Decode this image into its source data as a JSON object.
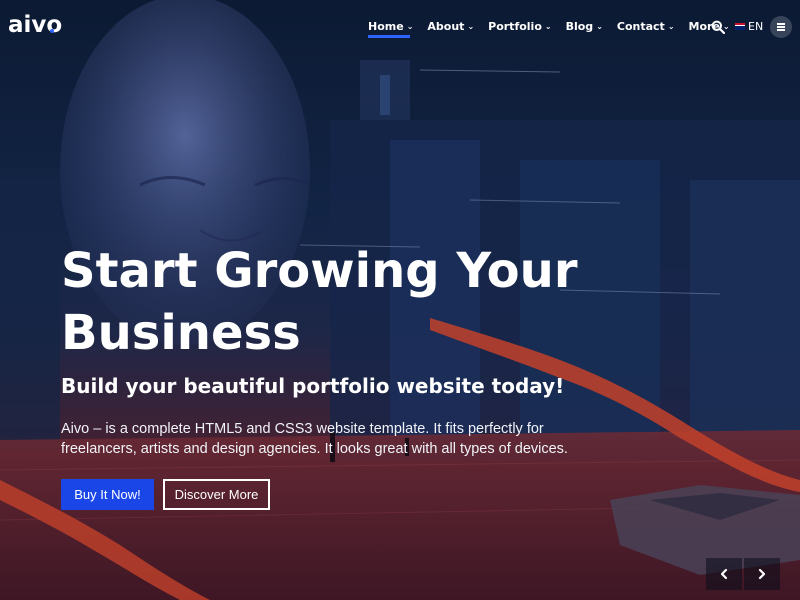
{
  "brand": {
    "logo": "aivo"
  },
  "nav": {
    "items": [
      {
        "label": "Home",
        "active": true
      },
      {
        "label": "About",
        "active": false
      },
      {
        "label": "Portfolio",
        "active": false
      },
      {
        "label": "Blog",
        "active": false
      },
      {
        "label": "Contact",
        "active": false
      },
      {
        "label": "More",
        "active": false
      }
    ],
    "language": "EN"
  },
  "hero": {
    "title_line1": "Start Growing Your",
    "title_line2": "Business",
    "subtitle": "Build your beautiful portfolio website today!",
    "description": "Aivo – is a complete HTML5 and CSS3 website template. It fits perfectly for freelancers, artists and design agencies. It looks great with all types of devices.",
    "primary_button": "Buy It Now!",
    "secondary_button": "Discover More"
  },
  "colors": {
    "accent": "#1a46e8",
    "nav_indicator": "#2f63ff"
  },
  "icons": {
    "search": "search-icon",
    "menu": "hamburger-icon",
    "prev": "chevron-left-icon",
    "next": "chevron-right-icon",
    "flag": "uk-flag-icon"
  }
}
